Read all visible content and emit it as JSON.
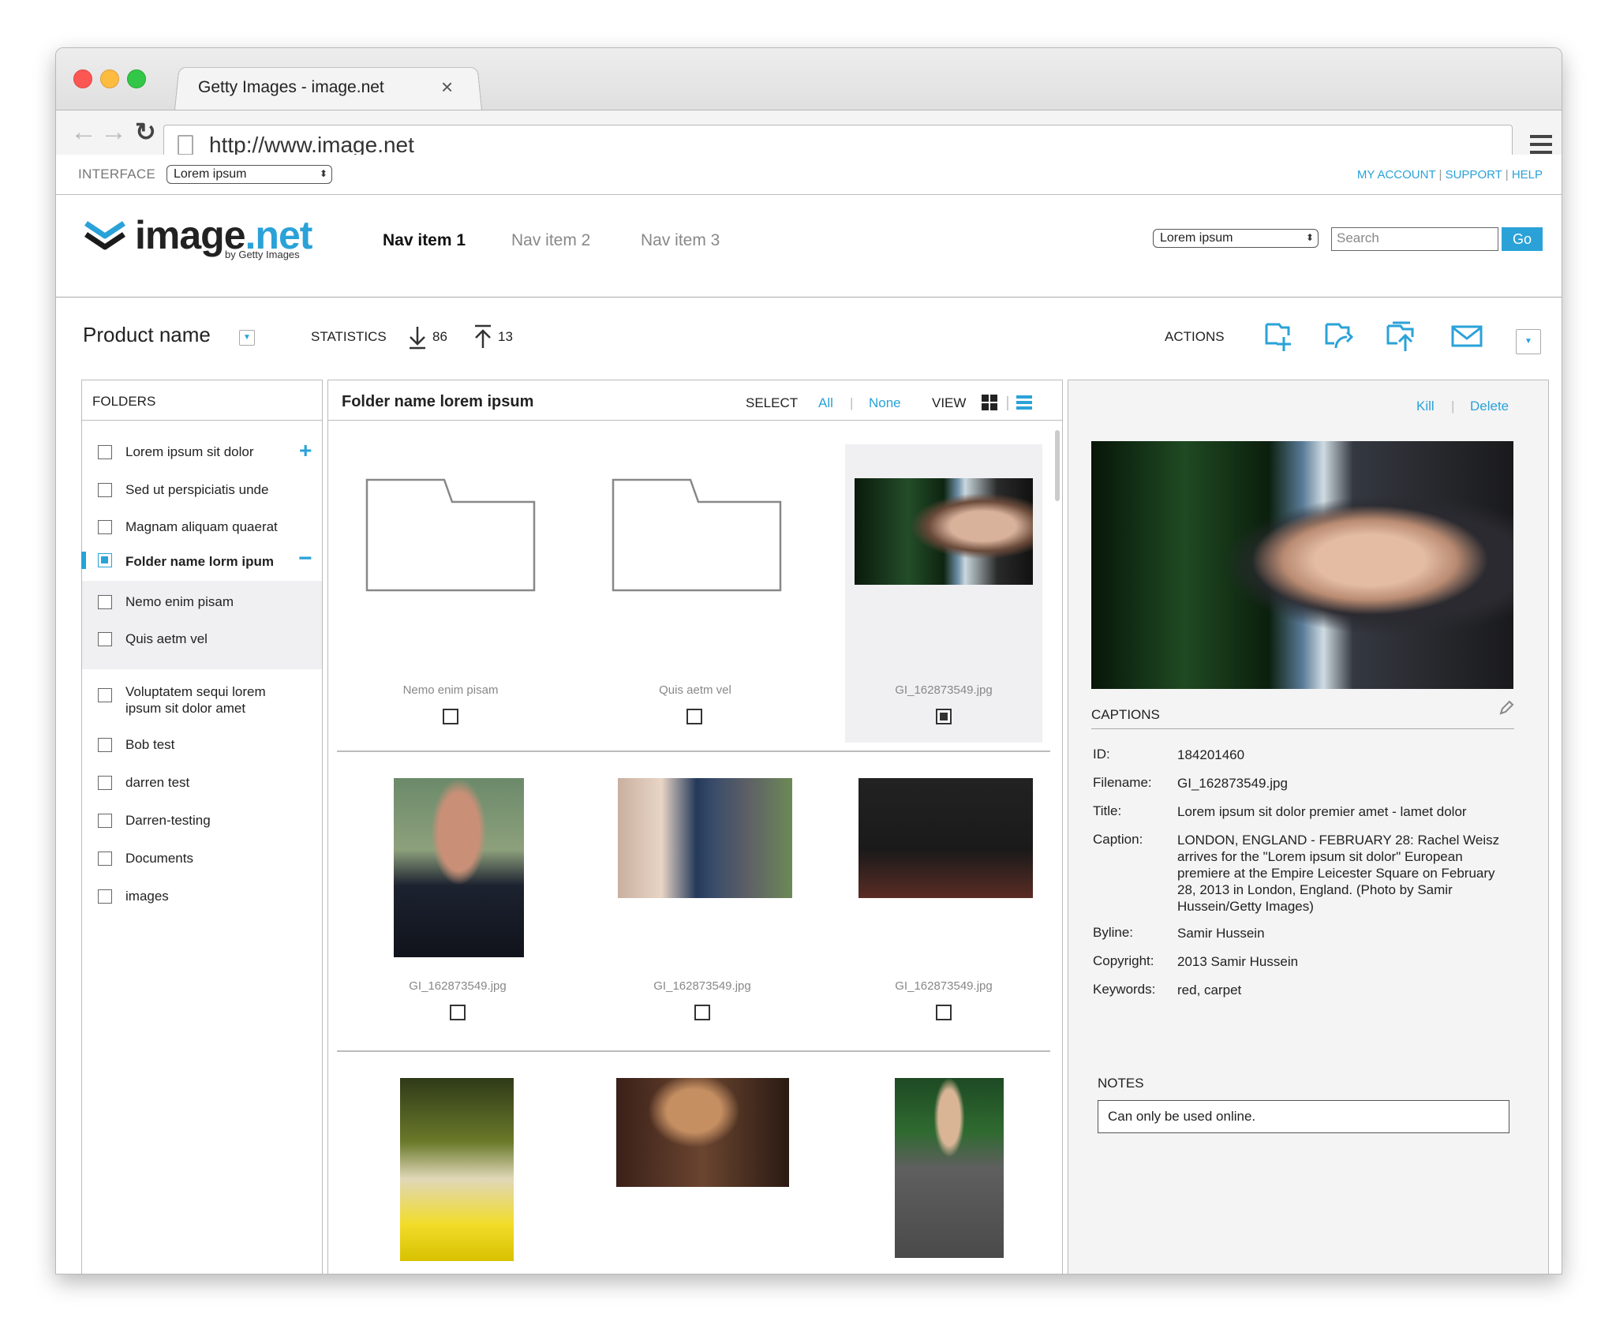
{
  "browser": {
    "tab_title": "Getty Images - image.net",
    "tab_close": "×",
    "url": "http://www.image.net",
    "back": "←",
    "forward": "→",
    "reload": "↻"
  },
  "topbar": {
    "interface_label": "INTERFACE",
    "interface_select": "Lorem ipsum",
    "links": [
      "MY ACCOUNT",
      "SUPPORT",
      "HELP"
    ],
    "separator": "|"
  },
  "header": {
    "logo_text": "image.net",
    "logo_sub": "by Getty Images",
    "nav": [
      "Nav item 1",
      "Nav item 2",
      "Nav item 3"
    ],
    "search_scope": "Lorem ipsum",
    "search_placeholder": "Search",
    "go_label": "Go"
  },
  "toolbar": {
    "product_name": "Product name",
    "statistics_label": "STATISTICS",
    "downloads": "86",
    "uploads": "13",
    "actions_label": "ACTIONS"
  },
  "folders": {
    "title": "FOLDERS",
    "add": "+",
    "collapse": "−",
    "items": [
      "Lorem ipsum sit dolor",
      "Sed ut perspiciatis unde",
      "Magnam aliquam quaerat",
      "Folder name lorm ipum",
      "Nemo enim pisam",
      "Quis aetm vel",
      "Voluptatem sequi lorem ipsum sit dolor amet",
      "Bob test",
      "darren test",
      "Darren-testing",
      "Documents",
      "images"
    ]
  },
  "grid": {
    "title": "Folder name lorem ipsum",
    "select_label": "SELECT",
    "select_all": "All",
    "select_none": "None",
    "view_label": "VIEW",
    "cells": [
      "Nemo enim pisam",
      "Quis aetm vel",
      "GI_162873549.jpg",
      "GI_162873549.jpg",
      "GI_162873549.jpg",
      "GI_162873549.jpg"
    ]
  },
  "detail": {
    "kill": "Kill",
    "delete": "Delete",
    "captions_title": "CAPTIONS",
    "fields": [
      {
        "k": "ID:",
        "v": "184201460"
      },
      {
        "k": "Filename:",
        "v": "GI_162873549.jpg"
      },
      {
        "k": "Title:",
        "v": "Lorem ipsum sit dolor premier amet - lamet dolor"
      },
      {
        "k": "Caption:",
        "v": "LONDON, ENGLAND - FEBRUARY 28: Rachel Weisz arrives for the \"Lorem ipsum sit dolor\" European premiere at the Empire Leicester Square on February 28, 2013 in London, England. (Photo by Samir Hussein/Getty Images)"
      },
      {
        "k": "Byline:",
        "v": "Samir Hussein"
      },
      {
        "k": "Copyright:",
        "v": "2013 Samir Hussein"
      },
      {
        "k": "Keywords:",
        "v": "red, carpet"
      }
    ],
    "notes_title": "NOTES",
    "notes_value": "Can only be used online."
  },
  "colors": {
    "accent": "#2aa2d8"
  }
}
